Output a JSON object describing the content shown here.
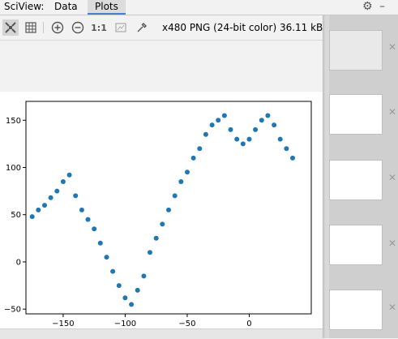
{
  "app": {
    "label": "SciView:"
  },
  "tabs": [
    {
      "label": "Data"
    },
    {
      "label": "Plots"
    }
  ],
  "toolbar": {
    "one_to_one_label": "1:1",
    "image_info": "x480 PNG (24-bit color) 36.11 kB"
  },
  "colors": {
    "accent": "#4a7fcf",
    "scatter": "#1f77b4"
  },
  "icons": [
    "fit-icon",
    "grid-icon",
    "zoom-in-icon",
    "zoom-out-icon",
    "actual-size-icon",
    "color-picker-icon",
    "gear-icon",
    "minimize-icon",
    "close-icon"
  ],
  "chart_data": {
    "type": "scatter",
    "title": "",
    "xlabel": "",
    "ylabel": "",
    "xlim": [
      -180,
      50
    ],
    "ylim": [
      -55,
      170
    ],
    "xticks": [
      -150,
      -100,
      -50,
      0
    ],
    "yticks": [
      -50,
      0,
      50,
      100,
      150
    ],
    "series": [
      {
        "x": [
          -175,
          -170,
          -165,
          -160,
          -155,
          -150,
          -145,
          -140,
          -135,
          -130,
          -125,
          -120,
          -115,
          -110,
          -105,
          -100,
          -95,
          -90,
          -85,
          -80,
          -75,
          -70,
          -65,
          -60,
          -55,
          -50,
          -45,
          -40,
          -35,
          -30,
          -25,
          -20,
          -15,
          -10,
          -5,
          0,
          5,
          10,
          15,
          20,
          25,
          30,
          35
        ],
        "y": [
          48,
          55,
          60,
          68,
          75,
          85,
          92,
          70,
          55,
          45,
          35,
          20,
          5,
          -10,
          -25,
          -38,
          -45,
          -30,
          -15,
          10,
          25,
          40,
          55,
          70,
          85,
          95,
          110,
          120,
          135,
          145,
          150,
          155,
          140,
          130,
          125,
          130,
          140,
          150,
          155,
          145,
          130,
          120,
          110
        ]
      }
    ]
  },
  "thumbnails": [
    {
      "id": "thumb-1"
    },
    {
      "id": "thumb-2"
    },
    {
      "id": "thumb-3"
    },
    {
      "id": "thumb-4"
    },
    {
      "id": "thumb-5"
    }
  ]
}
